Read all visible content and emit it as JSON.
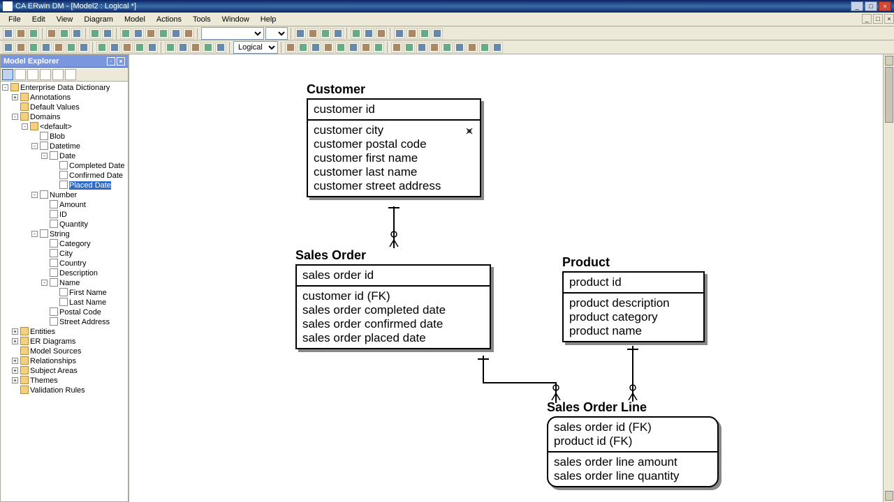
{
  "title": "CA ERwin DM - [Model2 : Logical *]",
  "menus": [
    "File",
    "Edit",
    "View",
    "Diagram",
    "Model",
    "Actions",
    "Tools",
    "Window",
    "Help"
  ],
  "view_mode": "Logical",
  "explorer": {
    "title": "Model Explorer",
    "tree": {
      "root": "Enterprise Data Dictionary",
      "annotations": "Annotations",
      "defaults": "Default Values",
      "domains": "Domains",
      "default_node": "<default>",
      "blob": "Blob",
      "datetime": "Datetime",
      "date": "Date",
      "completed_date": "Completed Date",
      "confirmed_date": "Confirmed Date",
      "placed_date": "Placed Date",
      "number": "Number",
      "amount": "Amount",
      "id": "ID",
      "quantity": "Quantity",
      "string": "String",
      "category": "Category",
      "city": "City",
      "country": "Country",
      "description": "Description",
      "name": "Name",
      "first_name": "First Name",
      "last_name": "Last Name",
      "postal_code": "Postal Code",
      "street_address": "Street Address",
      "entities": "Entities",
      "er_diagrams": "ER Diagrams",
      "model_sources": "Model Sources",
      "relationships": "Relationships",
      "subject_areas": "Subject Areas",
      "themes": "Themes",
      "validation_rules": "Validation Rules"
    }
  },
  "entities": {
    "customer": {
      "title": "Customer",
      "pk": "customer id",
      "attrs": [
        "customer city",
        "customer postal code",
        "customer first name",
        "customer last name",
        "customer street address"
      ]
    },
    "sales_order": {
      "title": "Sales Order",
      "pk": "sales order id",
      "attrs": [
        "customer id (FK)",
        "sales order completed date",
        "sales order confirmed date",
        "sales order placed date"
      ]
    },
    "product": {
      "title": "Product",
      "pk": "product id",
      "attrs": [
        "product description",
        "product category",
        "product name"
      ]
    },
    "sales_order_line": {
      "title": "Sales Order Line",
      "pk1": "sales order id (FK)",
      "pk2": "product id (FK)",
      "attrs": [
        "sales order line amount",
        "sales order line quantity"
      ]
    }
  }
}
